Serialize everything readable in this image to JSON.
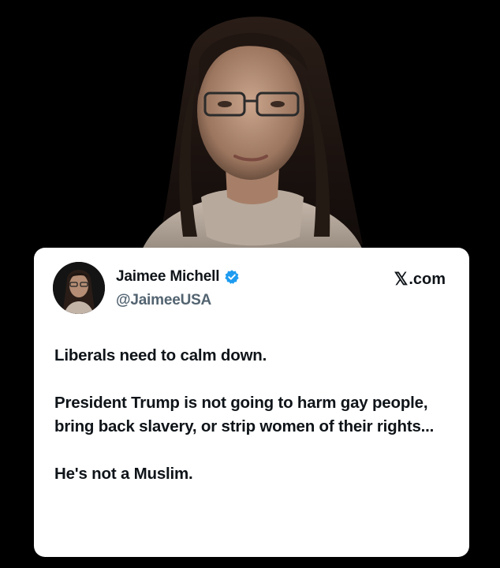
{
  "tweet": {
    "display_name": "Jaimee Michell",
    "handle": "@JaimeeUSA",
    "source": ".com",
    "paragraphs": [
      "Liberals need to calm down.",
      "President Trump is not going to harm gay people, bring back slavery, or strip women of their rights...",
      "He's not a Muslim."
    ]
  },
  "icons": {
    "verified": "verified-badge-icon",
    "x_logo": "x-logo-icon"
  },
  "colors": {
    "background": "#000000",
    "card": "#ffffff",
    "text": "#0f1419",
    "handle": "#536471",
    "verified": "#1d9bf0"
  }
}
